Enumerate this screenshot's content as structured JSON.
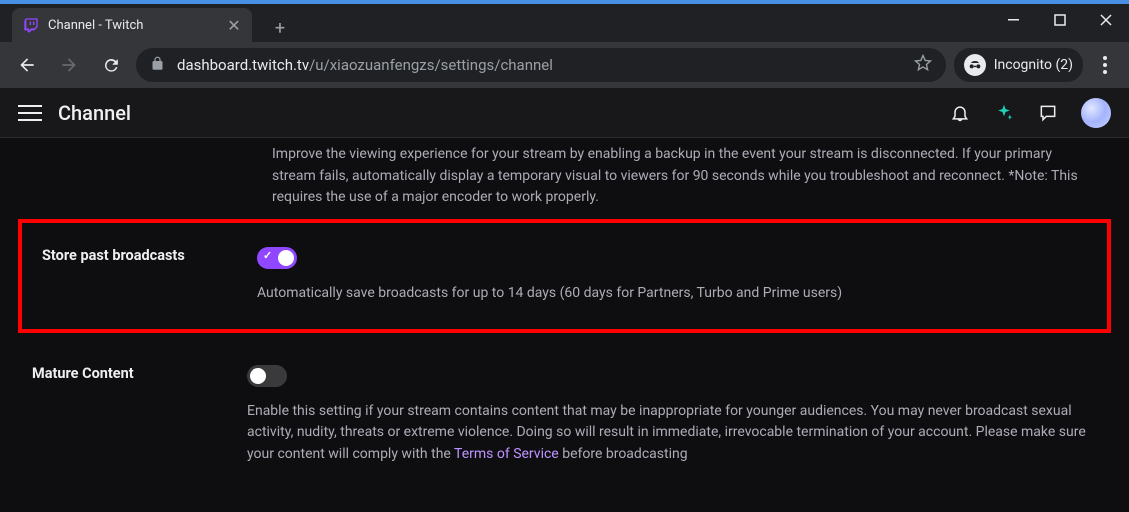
{
  "tab": {
    "title": "Channel - Twitch"
  },
  "url": {
    "host": "dashboard.twitch.tv",
    "path": "/u/xiaozuanfengzs/settings/channel"
  },
  "incognito": {
    "label": "Incognito (2)"
  },
  "header": {
    "title": "Channel"
  },
  "settings": {
    "backup": {
      "desc": "Improve the viewing experience for your stream by enabling a backup in the event your stream is disconnected. If your primary stream fails, automatically display a temporary visual to viewers for 90 seconds while you troubleshoot and reconnect. *Note: This requires the use of a major encoder to work properly."
    },
    "store": {
      "label": "Store past broadcasts",
      "desc": "Automatically save broadcasts for up to 14 days (60 days for Partners, Turbo and Prime users)"
    },
    "mature": {
      "label": "Mature Content",
      "desc_before_link": "Enable this setting if your stream contains content that may be inappropriate for younger audiences. You may never broadcast sexual activity, nudity, threats or extreme violence. Doing so will result in immediate, irrevocable termination of your account. Please make sure your content will comply with the ",
      "link_text": "Terms of Service",
      "desc_after_link": " before broadcasting"
    }
  }
}
